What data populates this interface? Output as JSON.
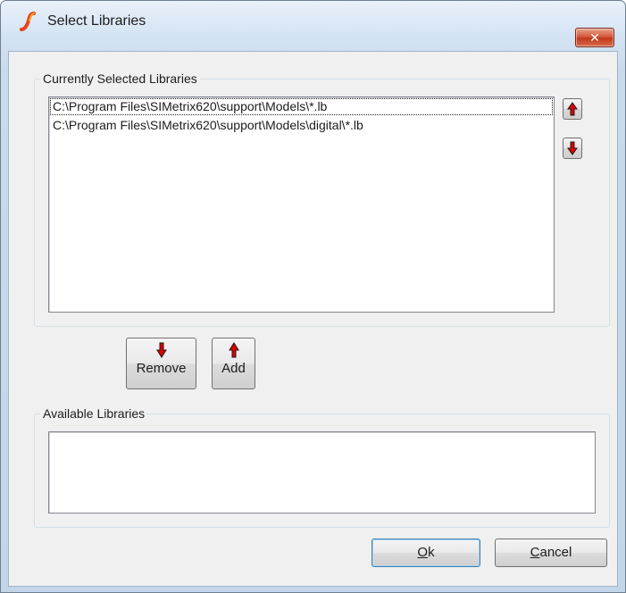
{
  "window": {
    "title": "Select Libraries",
    "close_symbol": "✕",
    "accent_color": "#c0391b"
  },
  "current_group": {
    "label": "Currently Selected Libraries",
    "items": [
      {
        "path": "C:\\Program Files\\SIMetrix620\\support\\Models\\*.lb",
        "focused": true
      },
      {
        "path": "C:\\Program Files\\SIMetrix620\\support\\Models\\digital\\*.lb",
        "focused": false
      }
    ],
    "move_up_icon": "arrow-up-icon",
    "move_down_icon": "arrow-down-icon"
  },
  "actions": {
    "remove_label": "Remove",
    "remove_icon": "arrow-down-icon",
    "add_label": "Add",
    "add_icon": "arrow-up-icon"
  },
  "available_group": {
    "label": "Available Libraries",
    "items": []
  },
  "footer": {
    "ok_mnemonic": "O",
    "ok_rest": "k",
    "cancel_mnemonic": "C",
    "cancel_rest": "ancel"
  },
  "colors": {
    "arrow": "#e00000"
  }
}
